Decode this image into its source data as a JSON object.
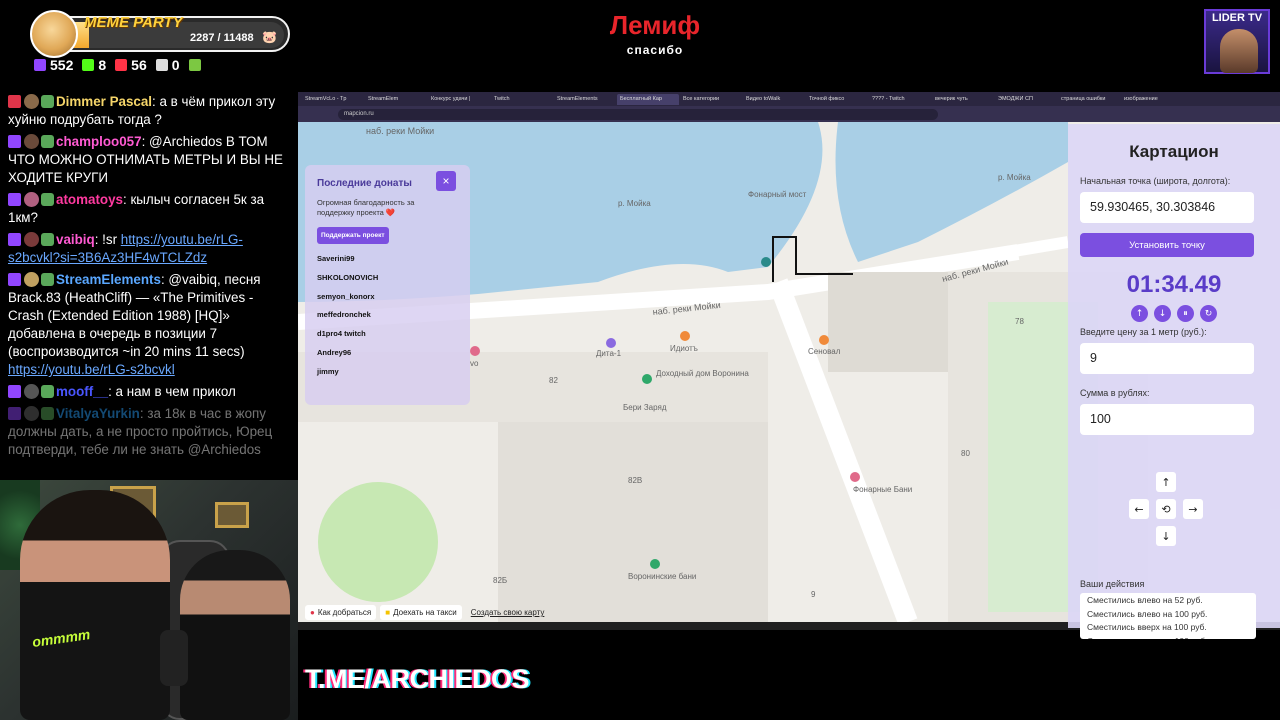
{
  "overlay": {
    "meme_party": {
      "title": "MEME PARTY",
      "count": "2287 / 11488",
      "progress_fraction": 0.199
    },
    "stats": [
      {
        "icon": "twitch-viewers-icon",
        "value": "552",
        "color": "#9146ff"
      },
      {
        "icon": "kick-viewers-icon",
        "value": "8",
        "color": "#53fc18"
      },
      {
        "icon": "vk-live-viewers-icon",
        "value": "56",
        "color": "#ff3347"
      },
      {
        "icon": "wasd-viewers-icon",
        "value": "0",
        "color": "#dddddd"
      },
      {
        "icon": "d-platform-icon",
        "value": "",
        "color": "#7cc842"
      }
    ],
    "lemif": {
      "title": "Лемиф",
      "subtitle": "спасибо"
    },
    "lider": {
      "title": "LIDER TV"
    },
    "tme": "T.ME/ARCHIEDOS"
  },
  "chat": [
    {
      "user": "Dimmer Pascal",
      "user_color": "#f6d66a",
      "platform_color": "#e0354a",
      "text": " а в чём прикол эту хуйню подрубать тогда ?",
      "link": "",
      "text_after": "",
      "faded": false
    },
    {
      "user": "champloo057",
      "user_color": "#ff5ad2",
      "platform_color": "#9146ff",
      "text": " @Archiedos В ТОМ ЧТО МОЖНО ОТНИМАТЬ МЕТРЫ И ВЫ НЕ ХОДИТЕ КРУГИ",
      "link": "",
      "text_after": "",
      "faded": false
    },
    {
      "user": "atomatoys",
      "user_color": "#ff3aa0",
      "platform_color": "#9146ff",
      "text": " кылыч согласен 5к за 1км?",
      "link": "",
      "text_after": "",
      "faded": false
    },
    {
      "user": "vaibiq",
      "user_color": "#ff5ad2",
      "platform_color": "#9146ff",
      "text": " !sr ",
      "link": "https://youtu.be/rLG-s2bcvkl?si=3B6Az3HF4wTCLZdz",
      "text_after": "",
      "faded": false
    },
    {
      "user": "StreamElements",
      "user_color": "#5aa7ff",
      "platform_color": "#9146ff",
      "text": " @vaibiq, песня Brack.83 (HeathCliff) — «The Primitives - Crash (Extended Edition 1988) [HQ]» добавлена в очередь в позиции 7 (воспроизводится ~in 20 mins 11 secs) ",
      "link": "https://youtu.be/rLG-s2bcvkl",
      "text_after": "",
      "faded": false
    },
    {
      "user": "mooff__",
      "user_color": "#4a56ff",
      "platform_color": "#9146ff",
      "text": " а нам в чем прикол",
      "link": "",
      "text_after": "",
      "faded": false
    },
    {
      "user": "VitalyaYurkin",
      "user_color": "#2aa3ff",
      "platform_color": "#9146ff",
      "text": " за 18к в час в жопу должны дать, а не просто пройтись, Юрец подтверди, тебе ли не знать @Archiedos",
      "link": "",
      "text_after": "",
      "faded": true
    }
  ],
  "webcam": {
    "shirt_text": "ommmm"
  },
  "browser": {
    "tabs": [
      "StreamVcLo - Tp",
      "StreamElem",
      "Конкурс удачи |",
      "Twitch",
      "StreamElements",
      "Бесплатный Кар",
      "Все категории",
      "Видео toWalk",
      "Точной фиксо",
      "???? - Twitch",
      "вечерик чуть",
      "ЭМОДЖИ СП",
      "страница ошибки",
      "изображение"
    ],
    "active_tab": 5,
    "url": "mapcion.ru"
  },
  "map": {
    "labels": {
      "emb1": "наб. реки Мойки",
      "emb2": "наб. реки Мойки",
      "emb3": "наб. реки Мойки",
      "river1": "р. Мойка",
      "river2": "р. Мойка",
      "bridge": "Фонарный мост",
      "dita": "Дита-1",
      "idiot": "Идиотъ",
      "senoval": "Сеновал",
      "voronin": "Доходный дом Воронина",
      "beri": "Бери Заряд",
      "baths": "Фонарные Бани",
      "voronin_baths": "Воронинские бани",
      "n78": "78",
      "n80": "80",
      "n82": "82",
      "n82v": "82В",
      "n82b": "82Б",
      "n9": "9",
      "vo": "vo"
    },
    "footer": {
      "route": "Как добраться",
      "taxi": "Доехать на такси",
      "create": "Создать свою карту",
      "ya": "Я"
    }
  },
  "donations": {
    "title": "Последние донаты",
    "close": "×",
    "text": "Огромная благодарность за поддержку проекта ❤️",
    "button": "Поддержать проект",
    "donors": [
      "Saverini99",
      "SHKOLONOVICH",
      "semyon_konorx",
      "meffedronchek",
      "d1pro4 twitch",
      "Andrey96",
      "jimmy"
    ]
  },
  "panel": {
    "title": "Картацион",
    "start_label": "Начальная точка (широта, долгота):",
    "start_value": "59.930465, 30.303846",
    "set_point": "Установить точку",
    "timer": "01:34.49",
    "controls": [
      "↑",
      "↓",
      "⏸",
      "↻"
    ],
    "price_label": "Введите цену за 1 метр (руб.):",
    "price_value": "9",
    "sum_label": "Сумма в рублях:",
    "sum_value": "100",
    "arrows": {
      "up": "↑",
      "left": "←",
      "reset": "⟲",
      "right": "→",
      "down": "↓"
    },
    "actions_label": "Ваши действия",
    "actions": [
      "Сместились влево на 52 руб.",
      "Сместились влево на 100 руб.",
      "Сместились вверх на 100 руб.",
      "Сместились влево на 100 руб."
    ]
  },
  "colors": {
    "accent": "#7b4fe0",
    "timer": "#5a3cc8",
    "water": "#a9cfe6"
  }
}
